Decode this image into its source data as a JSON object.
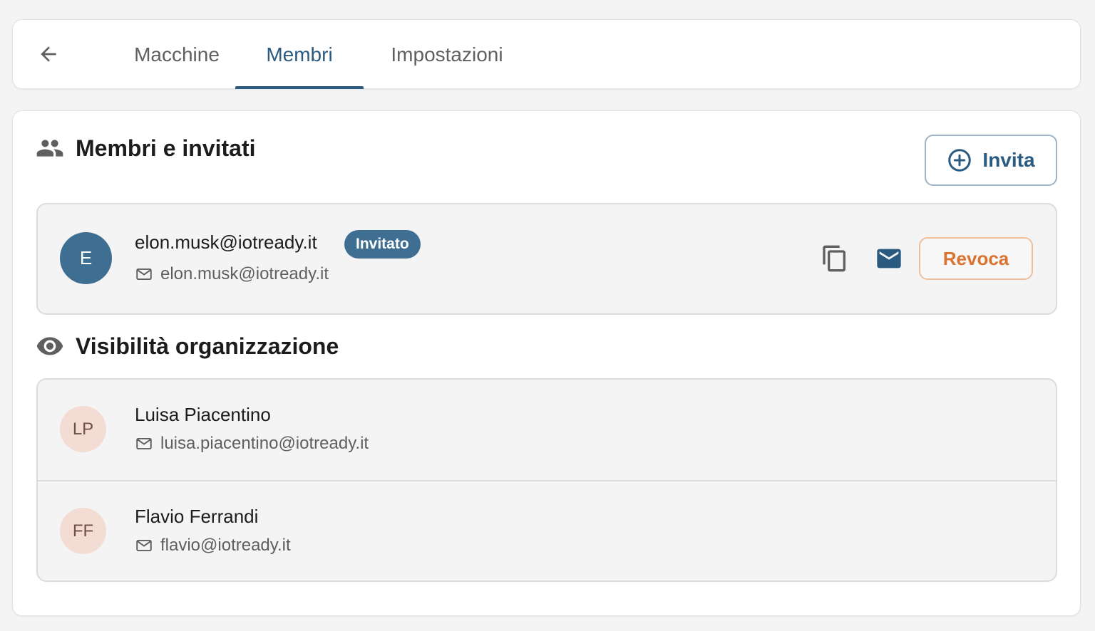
{
  "nav": {
    "back_icon": "arrow-left-icon",
    "tabs": [
      {
        "label": "Macchine",
        "active": false
      },
      {
        "label": "Membri",
        "active": true
      },
      {
        "label": "Impostazioni",
        "active": false
      }
    ]
  },
  "members_section": {
    "title": "Membri e invitati",
    "icon": "people-icon",
    "invite_label": "Invita",
    "invite_icon": "plus-circle-icon",
    "invited": [
      {
        "initial": "E",
        "name": "elon.musk@iotready.it",
        "badge": "Invitato",
        "email": "elon.musk@iotready.it",
        "copy_icon": "copy-icon",
        "mail_icon": "mail-icon",
        "revoke_label": "Revoca"
      }
    ]
  },
  "visibility_section": {
    "title": "Visibilità organizzazione",
    "icon": "eye-icon",
    "members": [
      {
        "initials": "LP",
        "name": "Luisa Piacentino",
        "email": "luisa.piacentino@iotready.it"
      },
      {
        "initials": "FF",
        "name": "Flavio Ferrandi",
        "email": "flavio@iotready.it"
      }
    ]
  },
  "colors": {
    "accent": "#2b5a80",
    "badge": "#3f6e93",
    "revoke": "#d9732f",
    "member_avatar_bg": "#f2dcd4"
  }
}
